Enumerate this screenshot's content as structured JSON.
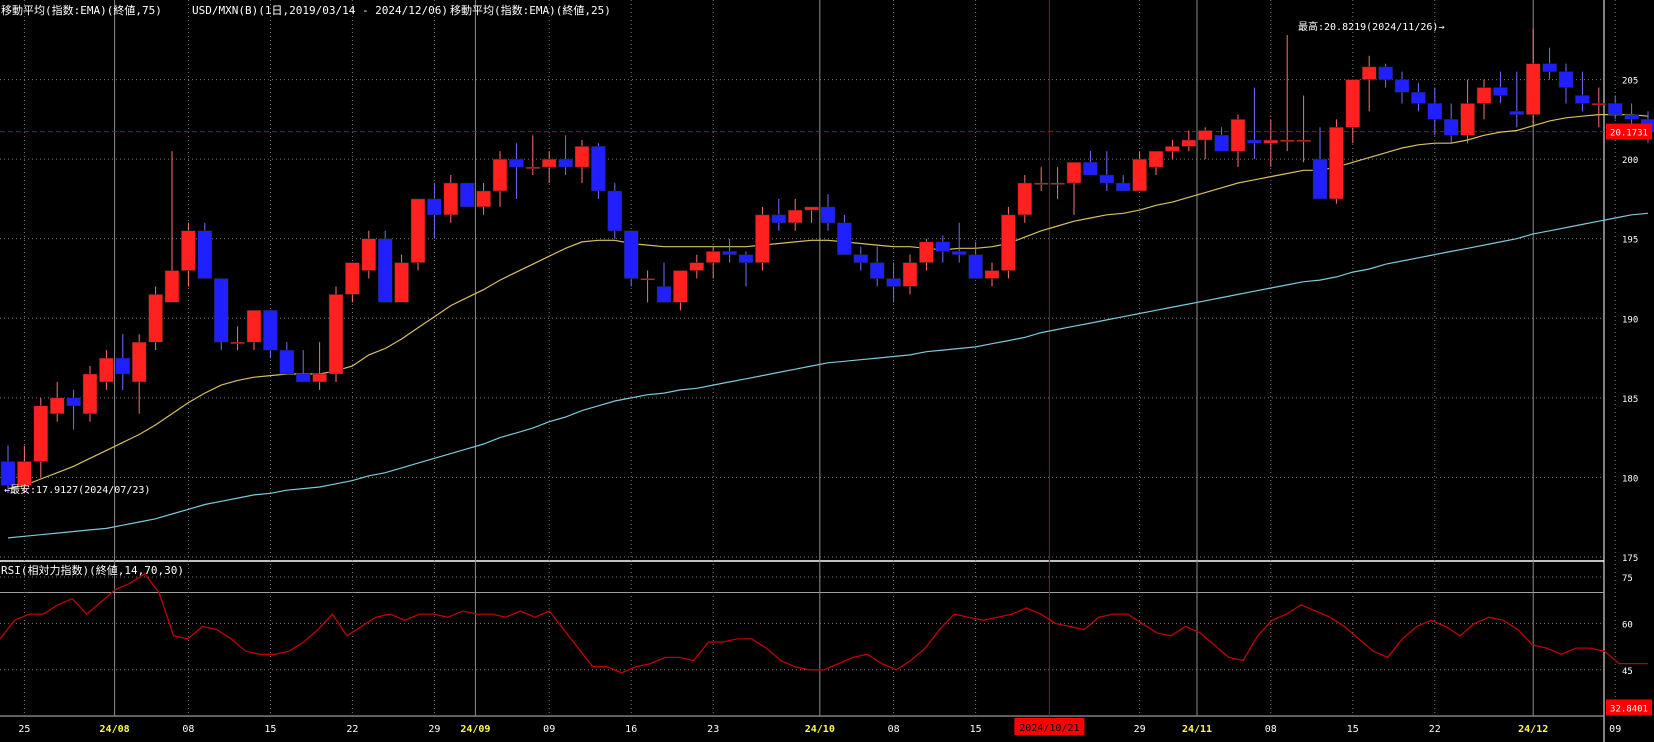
{
  "header": {
    "ema75_label": "移動平均(指数:EMA)(終値,75)",
    "instrument_label": "USD/MXN(B)(1日,2019/03/14 - 2024/12/06)",
    "ema25_label": "移動平均(指数:EMA)(終値,25)"
  },
  "annotations": {
    "high_label": "最高:20.8219(2024/11/26)→",
    "low_label": "←最安:17.9127(2024/07/23)"
  },
  "rsi_panel": {
    "label": "RSI(相対力指数)(終値,14,70,30)"
  },
  "colors": {
    "background": "#000000",
    "up": "#ff2020",
    "down": "#2020ff",
    "ema25": "#d8c060",
    "ema75": "#7ec8d8",
    "rsi": "#c00000",
    "grid": "#7a7a7a",
    "month_line": "#8c8c8c",
    "cursor": "#c00000",
    "text": "#ffffff",
    "month_text": "#ffff40",
    "current_badge": "#ff0000"
  },
  "chart_data": [
    {
      "type": "candlestick",
      "title": "USD/MXN(B)(1日,2019/03/14 - 2024/12/06)",
      "ylim": [
        17.5,
        21.0
      ],
      "y_ticks": [
        "175",
        "180",
        "185",
        "190",
        "195",
        "200",
        "205"
      ],
      "x_ticks": [
        "25",
        "24/08",
        "08",
        "15",
        "22",
        "29",
        "24/09",
        "09",
        "16",
        "23",
        "24/10",
        "08",
        "15",
        "24/11",
        "29",
        "24/11",
        "08",
        "15",
        "22",
        "24/12",
        "09"
      ],
      "x_tick_labels": [
        {
          "label": "25",
          "bar": 1
        },
        {
          "label": "24/08",
          "bar": 6.5
        },
        {
          "label": "08",
          "bar": 11
        },
        {
          "label": "15",
          "bar": 16
        },
        {
          "label": "22",
          "bar": 21
        },
        {
          "label": "29",
          "bar": 26
        },
        {
          "label": "24/09",
          "bar": 28.5
        },
        {
          "label": "09",
          "bar": 33
        },
        {
          "label": "16",
          "bar": 38
        },
        {
          "label": "23",
          "bar": 43
        },
        {
          "label": "24/10",
          "bar": 49.5
        },
        {
          "label": "08",
          "bar": 54
        },
        {
          "label": "15",
          "bar": 59
        },
        {
          "label": "29",
          "bar": 69
        },
        {
          "label": "24/11",
          "bar": 72.5
        },
        {
          "label": "08",
          "bar": 77
        },
        {
          "label": "15",
          "bar": 82
        },
        {
          "label": "22",
          "bar": 87
        },
        {
          "label": "24/12",
          "bar": 93
        },
        {
          "label": "09",
          "bar": 98
        }
      ],
      "cursor": {
        "label": "2024/10/21",
        "bar": 63.5
      },
      "current_value_label": "20.1731",
      "current_value": 20.1731,
      "month_bars": [
        6.5,
        28.5,
        49.5,
        72.5,
        93
      ],
      "candles": [
        [
          18.1,
          18.2,
          17.9,
          17.95
        ],
        [
          17.95,
          18.2,
          17.9,
          18.1
        ],
        [
          18.1,
          18.5,
          18.0,
          18.45
        ],
        [
          18.4,
          18.6,
          18.35,
          18.5
        ],
        [
          18.5,
          18.55,
          18.3,
          18.45
        ],
        [
          18.4,
          18.7,
          18.35,
          18.65
        ],
        [
          18.6,
          18.8,
          18.55,
          18.75
        ],
        [
          18.75,
          18.9,
          18.55,
          18.65
        ],
        [
          18.6,
          18.9,
          18.4,
          18.85
        ],
        [
          18.85,
          19.2,
          18.8,
          19.15
        ],
        [
          19.1,
          20.05,
          19.1,
          19.3
        ],
        [
          19.3,
          19.6,
          19.2,
          19.55
        ],
        [
          19.55,
          19.6,
          19.25,
          19.25
        ],
        [
          19.25,
          19.25,
          18.8,
          18.85
        ],
        [
          18.85,
          18.95,
          18.8,
          18.85
        ],
        [
          18.85,
          19.05,
          18.8,
          19.05
        ],
        [
          19.05,
          19.05,
          18.75,
          18.8
        ],
        [
          18.8,
          18.85,
          18.65,
          18.65
        ],
        [
          18.65,
          18.8,
          18.6,
          18.6
        ],
        [
          18.6,
          18.85,
          18.55,
          18.65
        ],
        [
          18.65,
          19.2,
          18.6,
          19.15
        ],
        [
          19.15,
          19.35,
          19.1,
          19.35
        ],
        [
          19.3,
          19.55,
          19.25,
          19.5
        ],
        [
          19.5,
          19.55,
          19.1,
          19.1
        ],
        [
          19.1,
          19.4,
          19.1,
          19.35
        ],
        [
          19.35,
          19.75,
          19.3,
          19.75
        ],
        [
          19.75,
          19.85,
          19.5,
          19.65
        ],
        [
          19.65,
          19.9,
          19.6,
          19.85
        ],
        [
          19.85,
          19.85,
          19.7,
          19.7
        ],
        [
          19.7,
          19.85,
          19.65,
          19.8
        ],
        [
          19.8,
          20.05,
          19.7,
          20.0
        ],
        [
          20.0,
          20.1,
          19.75,
          19.95
        ],
        [
          19.95,
          20.15,
          19.9,
          19.95
        ],
        [
          19.95,
          20.05,
          19.85,
          20.0
        ],
        [
          20.0,
          20.15,
          19.9,
          19.95
        ],
        [
          19.95,
          20.12,
          19.85,
          20.08
        ],
        [
          20.08,
          20.1,
          19.75,
          19.8
        ],
        [
          19.8,
          19.85,
          19.5,
          19.55
        ],
        [
          19.55,
          19.55,
          19.2,
          19.25
        ],
        [
          19.25,
          19.3,
          19.1,
          19.25
        ],
        [
          19.2,
          19.35,
          19.1,
          19.1
        ],
        [
          19.1,
          19.3,
          19.05,
          19.3
        ],
        [
          19.3,
          19.4,
          19.25,
          19.35
        ],
        [
          19.35,
          19.45,
          19.25,
          19.42
        ],
        [
          19.42,
          19.5,
          19.35,
          19.4
        ],
        [
          19.4,
          19.42,
          19.2,
          19.35
        ],
        [
          19.35,
          19.7,
          19.3,
          19.65
        ],
        [
          19.65,
          19.75,
          19.55,
          19.6
        ],
        [
          19.6,
          19.75,
          19.55,
          19.68
        ],
        [
          19.68,
          19.7,
          19.6,
          19.7
        ],
        [
          19.7,
          19.78,
          19.55,
          19.6
        ],
        [
          19.6,
          19.65,
          19.4,
          19.4
        ],
        [
          19.4,
          19.45,
          19.3,
          19.35
        ],
        [
          19.35,
          19.45,
          19.2,
          19.25
        ],
        [
          19.25,
          19.35,
          19.1,
          19.2
        ],
        [
          19.2,
          19.4,
          19.15,
          19.35
        ],
        [
          19.35,
          19.5,
          19.3,
          19.48
        ],
        [
          19.48,
          19.52,
          19.35,
          19.42
        ],
        [
          19.42,
          19.6,
          19.35,
          19.4
        ],
        [
          19.4,
          19.48,
          19.25,
          19.25
        ],
        [
          19.25,
          19.35,
          19.2,
          19.3
        ],
        [
          19.3,
          19.7,
          19.25,
          19.65
        ],
        [
          19.65,
          19.9,
          19.6,
          19.85
        ],
        [
          19.85,
          19.95,
          19.8,
          19.85
        ],
        [
          19.85,
          19.95,
          19.75,
          19.85
        ],
        [
          19.85,
          19.9,
          19.65,
          19.98
        ],
        [
          19.98,
          20.05,
          19.9,
          19.9
        ],
        [
          19.9,
          20.05,
          19.8,
          19.85
        ],
        [
          19.85,
          19.9,
          19.8,
          19.8
        ],
        [
          19.8,
          20.05,
          19.8,
          20.0
        ],
        [
          19.95,
          20.05,
          19.9,
          20.05
        ],
        [
          20.05,
          20.12,
          20.0,
          20.08
        ],
        [
          20.08,
          20.18,
          20.05,
          20.12
        ],
        [
          20.12,
          20.2,
          20.0,
          20.18
        ],
        [
          20.15,
          20.2,
          20.05,
          20.05
        ],
        [
          20.05,
          20.28,
          19.95,
          20.25
        ],
        [
          20.12,
          20.45,
          20.0,
          20.1
        ],
        [
          20.1,
          20.25,
          19.95,
          20.12
        ],
        [
          20.12,
          20.78,
          20.05,
          20.12
        ],
        [
          20.12,
          20.4,
          19.98,
          20.12
        ],
        [
          20.0,
          20.2,
          19.75,
          19.75
        ],
        [
          19.75,
          20.25,
          19.72,
          20.2
        ],
        [
          20.2,
          20.45,
          20.1,
          20.5
        ],
        [
          20.5,
          20.65,
          20.3,
          20.58
        ],
        [
          20.58,
          20.6,
          20.45,
          20.5
        ],
        [
          20.5,
          20.55,
          20.35,
          20.42
        ],
        [
          20.42,
          20.48,
          20.3,
          20.35
        ],
        [
          20.35,
          20.45,
          20.15,
          20.25
        ],
        [
          20.25,
          20.35,
          20.1,
          20.15
        ],
        [
          20.15,
          20.5,
          20.1,
          20.35
        ],
        [
          20.35,
          20.5,
          20.25,
          20.45
        ],
        [
          20.45,
          20.55,
          20.35,
          20.4
        ],
        [
          20.3,
          20.55,
          20.2,
          20.28
        ],
        [
          20.28,
          20.82,
          20.2,
          20.6
        ],
        [
          20.6,
          20.7,
          20.5,
          20.55
        ],
        [
          20.55,
          20.6,
          20.35,
          20.45
        ],
        [
          20.4,
          20.55,
          20.3,
          20.35
        ],
        [
          20.35,
          20.45,
          20.2,
          20.35
        ],
        [
          20.35,
          20.4,
          20.25,
          20.28
        ],
        [
          20.28,
          20.35,
          20.2,
          20.25
        ],
        [
          20.25,
          20.3,
          20.1,
          20.17
        ]
      ],
      "ema25": [
        17.93,
        17.95,
        17.99,
        18.03,
        18.07,
        18.12,
        18.17,
        18.22,
        18.27,
        18.33,
        18.4,
        18.47,
        18.53,
        18.58,
        18.61,
        18.63,
        18.64,
        18.65,
        18.65,
        18.65,
        18.67,
        18.7,
        18.77,
        18.81,
        18.87,
        18.94,
        19.01,
        19.08,
        19.13,
        19.18,
        19.24,
        19.29,
        19.34,
        19.39,
        19.44,
        19.48,
        19.49,
        19.49,
        19.47,
        19.46,
        19.45,
        19.45,
        19.45,
        19.45,
        19.45,
        19.45,
        19.46,
        19.47,
        19.48,
        19.49,
        19.49,
        19.48,
        19.47,
        19.46,
        19.45,
        19.45,
        19.44,
        19.43,
        19.44,
        19.44,
        19.45,
        19.47,
        19.51,
        19.55,
        19.58,
        19.61,
        19.63,
        19.65,
        19.66,
        19.68,
        19.71,
        19.73,
        19.76,
        19.79,
        19.82,
        19.85,
        19.87,
        19.89,
        19.91,
        19.93,
        19.93,
        19.95,
        19.98,
        20.01,
        20.04,
        20.07,
        20.09,
        20.1,
        20.1,
        20.12,
        20.15,
        20.17,
        20.18,
        20.21,
        20.24,
        20.26,
        20.27,
        20.28,
        20.28,
        20.28,
        20.27
      ],
      "ema75": [
        17.62,
        17.63,
        17.64,
        17.65,
        17.66,
        17.67,
        17.68,
        17.7,
        17.72,
        17.74,
        17.77,
        17.8,
        17.83,
        17.85,
        17.87,
        17.89,
        17.9,
        17.92,
        17.93,
        17.94,
        17.96,
        17.98,
        18.01,
        18.03,
        18.06,
        18.09,
        18.12,
        18.15,
        18.18,
        18.21,
        18.25,
        18.28,
        18.31,
        18.35,
        18.38,
        18.42,
        18.45,
        18.48,
        18.5,
        18.52,
        18.53,
        18.55,
        18.56,
        18.58,
        18.6,
        18.62,
        18.64,
        18.66,
        18.68,
        18.7,
        18.72,
        18.73,
        18.74,
        18.75,
        18.76,
        18.77,
        18.79,
        18.8,
        18.81,
        18.82,
        18.84,
        18.86,
        18.88,
        18.91,
        18.93,
        18.95,
        18.97,
        18.99,
        19.01,
        19.03,
        19.05,
        19.07,
        19.09,
        19.11,
        19.13,
        19.15,
        19.17,
        19.19,
        19.21,
        19.23,
        19.24,
        19.26,
        19.29,
        19.31,
        19.34,
        19.36,
        19.38,
        19.4,
        19.42,
        19.44,
        19.46,
        19.48,
        19.5,
        19.53,
        19.55,
        19.57,
        19.59,
        19.61,
        19.63,
        19.65,
        19.66
      ]
    },
    {
      "type": "line",
      "title": "RSI(相対力指数)(終値,14,70,30)",
      "ylim": [
        30,
        77
      ],
      "y_ticks": [
        "75",
        "60",
        "45"
      ],
      "levels": [
        70,
        30
      ],
      "current_value_label": "32.8401",
      "current_value": 32.8401,
      "values": [
        55,
        61,
        63,
        63,
        66,
        68,
        63,
        67,
        71,
        73,
        76,
        70,
        56,
        55,
        59,
        58,
        55,
        51,
        50,
        50,
        51,
        54,
        58,
        63,
        56,
        59,
        62,
        63,
        61,
        63,
        63,
        62,
        64,
        63,
        63,
        62,
        64,
        62,
        64,
        58,
        52,
        46,
        46,
        44,
        46,
        47,
        49,
        49,
        48,
        54,
        54,
        55,
        55,
        52,
        48,
        46,
        45,
        45,
        47,
        49,
        50,
        47,
        45,
        48,
        52,
        58,
        63,
        62,
        61,
        62,
        63,
        65,
        63,
        60,
        59,
        58,
        62,
        63,
        63,
        60,
        57,
        56,
        59,
        57,
        53,
        49,
        48,
        56,
        61,
        63,
        66,
        64,
        62,
        59,
        55,
        51,
        49,
        55,
        59,
        61,
        59,
        56,
        60,
        62,
        61,
        58,
        53,
        52,
        50,
        52,
        52,
        51,
        47,
        47,
        47
      ]
    }
  ]
}
